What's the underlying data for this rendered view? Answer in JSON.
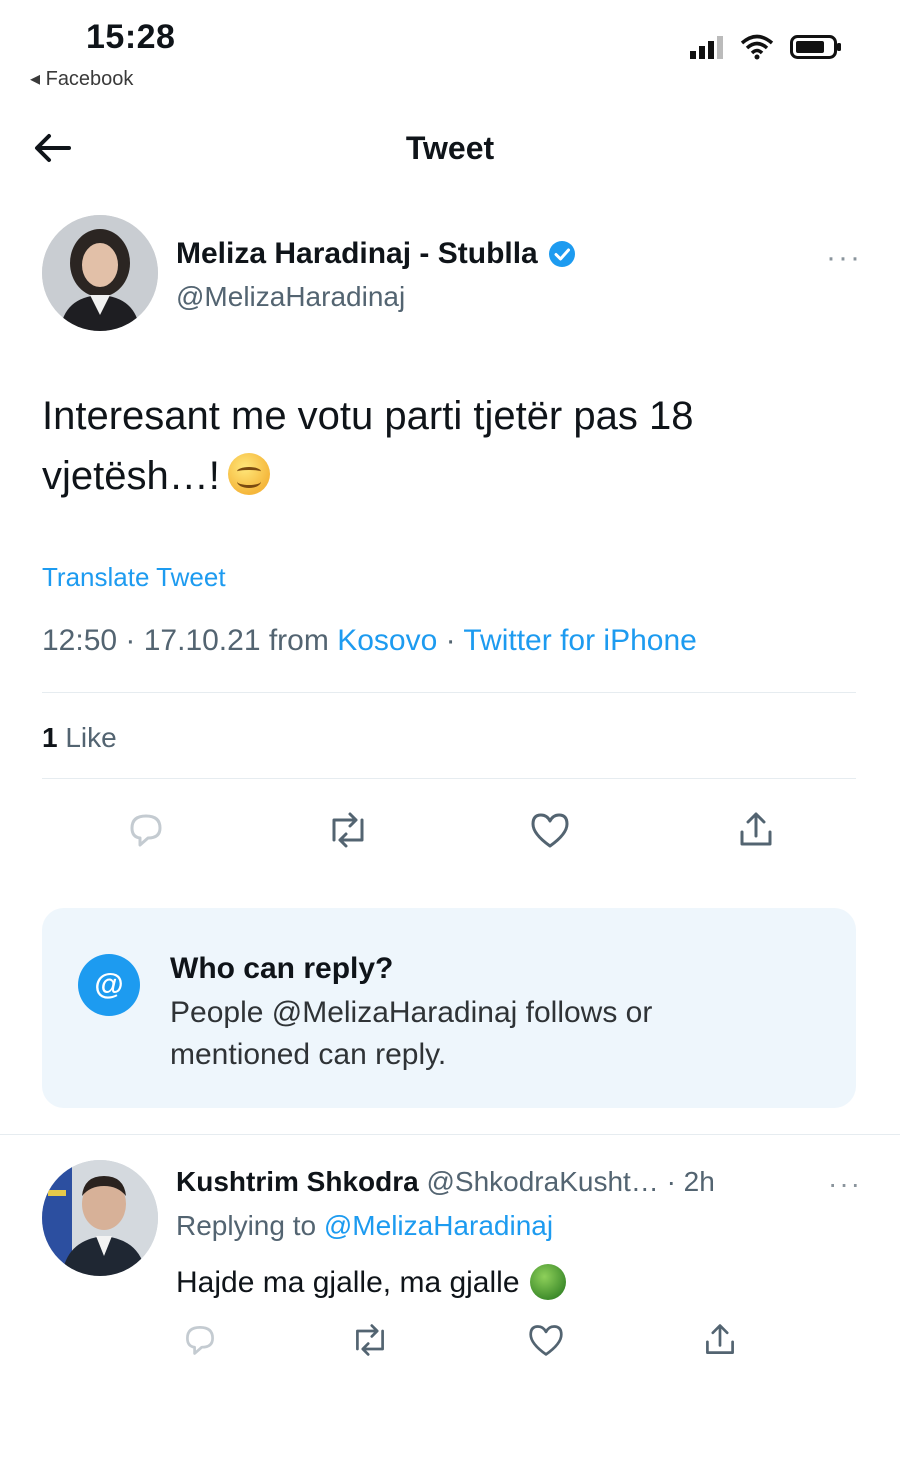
{
  "status_bar": {
    "time": "15:28",
    "back_app": "◂ Facebook"
  },
  "header": {
    "title": "Tweet"
  },
  "tweet": {
    "author_name": "Meliza Haradinaj - Stublla",
    "author_handle": "@MelizaHaradinaj",
    "more": "···",
    "text": "Interesant me votu parti tjetër pas 18 vjetësh…!",
    "translate_label": "Translate Tweet",
    "timestamp": "12:50 · 17.10.21 from ",
    "location": "Kosovo",
    "separator": " · ",
    "source": "Twitter for iPhone",
    "likes_count": "1",
    "likes_label": " Like"
  },
  "reply_restriction": {
    "title": "Who can reply?",
    "description": "People @MelizaHaradinaj follows or mentioned can reply."
  },
  "reply": {
    "author_name": "Kushtrim Shkodra",
    "author_handle": " @ShkodraKusht…",
    "time": " · 2h",
    "more": "···",
    "replying_label": "Replying to ",
    "replying_handle": "@MelizaHaradinaj",
    "text": "Hajde ma gjalle, ma gjalle"
  },
  "colors": {
    "accent": "#1d9bf0",
    "muted": "#536471",
    "card_bg": "#eef6fc"
  }
}
